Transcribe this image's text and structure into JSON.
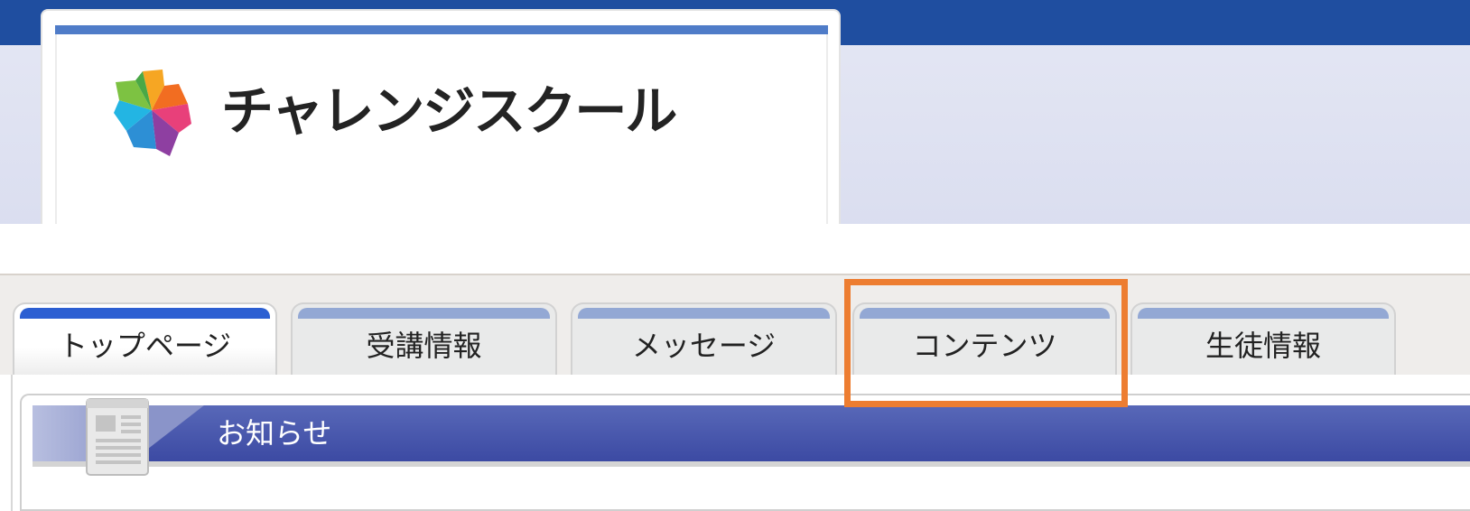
{
  "header": {
    "logo_text": "チャレンジスクール"
  },
  "tabs": [
    {
      "label": "トップページ",
      "active": true
    },
    {
      "label": "受講情報",
      "active": false
    },
    {
      "label": "メッセージ",
      "active": false
    },
    {
      "label": "コンテンツ",
      "active": false,
      "highlighted": true
    },
    {
      "label": "生徒情報",
      "active": false
    }
  ],
  "notice": {
    "title": "お知らせ"
  },
  "colors": {
    "top_bar": "#1f4ea0",
    "highlight": "#ed7d31",
    "active_tab_strip": "#2c5fd2",
    "tab_strip": "#93a8d4",
    "notice_bar": "#3c4aa3"
  }
}
